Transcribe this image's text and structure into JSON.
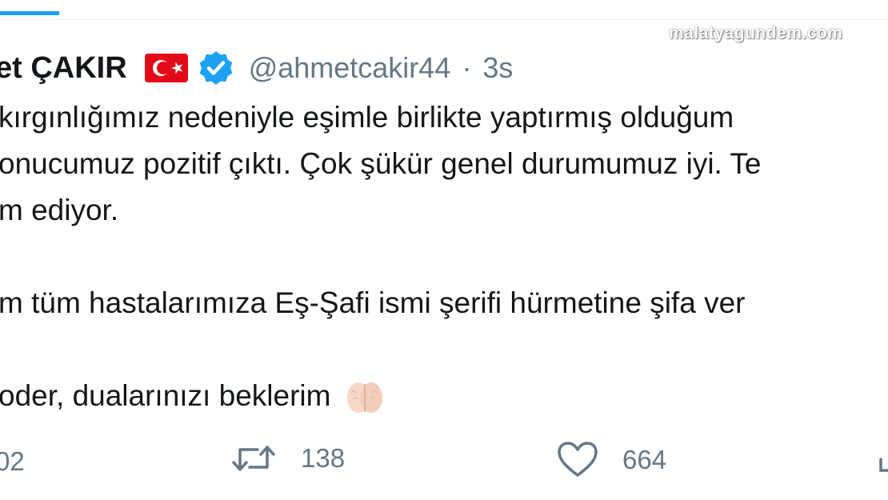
{
  "watermark": "malatyagundem.com",
  "tweet": {
    "author_name": "et ÇAKIR",
    "handle": "@ahmetcakir44",
    "separator": "·",
    "time": "3s",
    "lines": [
      "kırgınlığımız nedeniyle eşimle birlikte yaptırmış olduğum",
      "onucumuz pozitif çıktı. Çok şükür genel durumumuz iyi. Te",
      "m ediyor.",
      "",
      "m tüm hastalarımıza Eş-Şafi ismi şerifi hürmetine şifa ver",
      "",
      "oder, dualarınızı beklerim"
    ]
  },
  "actions": {
    "reply_count": "02",
    "retweet_count": "138",
    "like_count": "664"
  },
  "icons": {
    "flag": "turkish-flag-icon",
    "verified": "verified-badge-icon",
    "retweet": "retweet-icon",
    "like": "heart-icon",
    "emoji": "praying-hands-emoji"
  },
  "colors": {
    "accent": "#1da1f2",
    "text": "#14171a",
    "muted": "#657786",
    "flag_red": "#e30a17"
  }
}
